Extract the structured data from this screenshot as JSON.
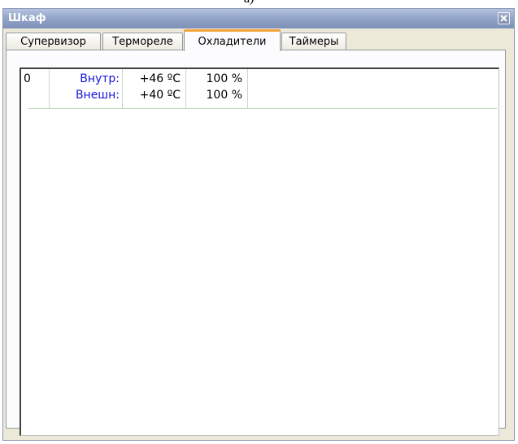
{
  "top_fragment": "a)",
  "window": {
    "title": "Шкаф",
    "close_icon": "close-icon"
  },
  "tabs": [
    {
      "label": "Супервизор",
      "active": false
    },
    {
      "label": "Термореле",
      "active": false
    },
    {
      "label": "Охладители",
      "active": true
    },
    {
      "label": "Таймеры",
      "active": false
    }
  ],
  "cooler_list": {
    "rows": [
      {
        "index": "0",
        "labels": [
          "Внутр:",
          "Внешн:"
        ],
        "temperatures": [
          "+46 ºC",
          "+40 ºC"
        ],
        "percents": [
          "100 %",
          "100 %"
        ]
      }
    ]
  },
  "colors": {
    "label_blue": "#1414d8",
    "active_tab_accent": "#f2a33a",
    "window_face": "#ece9d8"
  }
}
